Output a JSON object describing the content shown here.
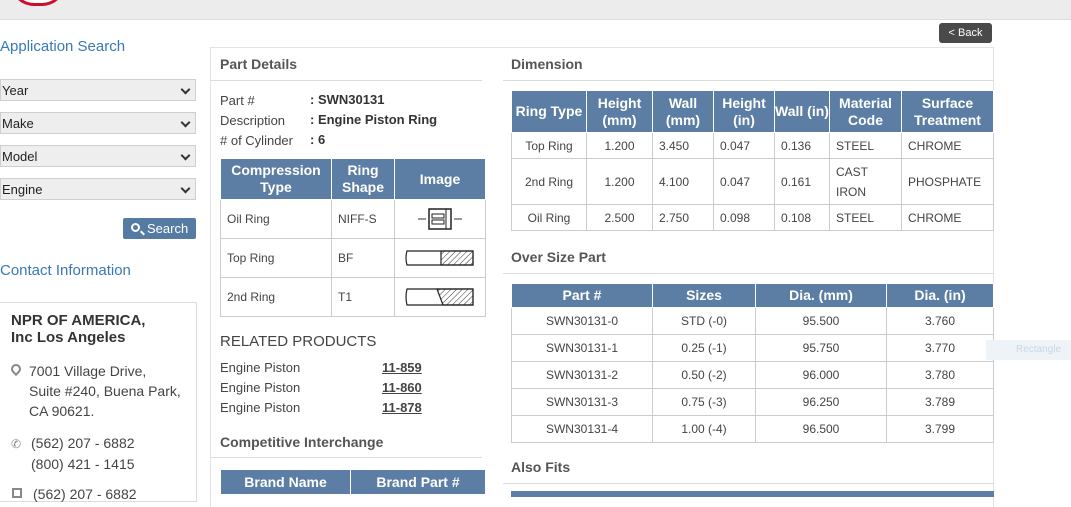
{
  "sidebar": {
    "app_search_title": "Application Search",
    "selects": [
      "Year",
      "Make",
      "Model",
      "Engine"
    ],
    "search_label": "Search",
    "contact_title": "Contact Information",
    "company_line1": "NPR OF AMERICA,",
    "company_line2": "Inc Los Angeles",
    "address_lines": [
      "7001 Village Drive,",
      "Suite #240, Buena Park,",
      "CA 90621."
    ],
    "phones": [
      "(562) 207 - 6882",
      "(800) 421 - 1415"
    ],
    "fax": "(562) 207 - 6882"
  },
  "back_label": "< Back",
  "part_details": {
    "title": "Part Details",
    "part_label": "Part #",
    "part_value": ": SWN30131",
    "desc_label": "Description",
    "desc_value": ": Engine Piston Ring",
    "cyl_label": "# of Cylinder",
    "cyl_value": ": 6",
    "ring_table": {
      "headers": [
        "Compression Type",
        "Ring Shape",
        "Image"
      ],
      "rows": [
        {
          "type": "Oil Ring",
          "shape": "NIFF-S",
          "image_icon": "oil-ring-profile-icon"
        },
        {
          "type": "Top Ring",
          "shape": "BF",
          "image_icon": "top-ring-profile-icon"
        },
        {
          "type": "2nd Ring",
          "shape": "T1",
          "image_icon": "second-ring-profile-icon"
        }
      ]
    }
  },
  "related": {
    "title": "RELATED PRODUCTS",
    "items": [
      {
        "name": "Engine Piston",
        "part": "11-859"
      },
      {
        "name": "Engine Piston",
        "part": "11-860"
      },
      {
        "name": "Engine Piston",
        "part": "11-878"
      }
    ]
  },
  "interchange": {
    "title": "Competitive Interchange",
    "headers": [
      "Brand Name",
      "Brand Part #"
    ]
  },
  "dimension": {
    "title": "Dimension",
    "headers": [
      "Ring Type",
      "Height (mm)",
      "Wall (mm)",
      "Height (in)",
      "Wall (in)",
      "Material Code",
      "Surface Treatment"
    ],
    "rows": [
      [
        "Top Ring",
        "1.200",
        "3.450",
        "0.047",
        "0.136",
        "STEEL",
        "CHROME"
      ],
      [
        "2nd Ring",
        "1.200",
        "4.100",
        "0.047",
        "0.161",
        "CAST IRON",
        "PHOSPHATE"
      ],
      [
        "Oil Ring",
        "2.500",
        "2.750",
        "0.098",
        "0.108",
        "STEEL",
        "CHROME"
      ]
    ]
  },
  "oversize": {
    "title": "Over Size Part",
    "headers": [
      "Part #",
      "Sizes",
      "Dia. (mm)",
      "Dia. (in)"
    ],
    "rows": [
      [
        "SWN30131-0",
        "STD (-0)",
        "95.500",
        "3.760"
      ],
      [
        "SWN30131-1",
        "0.25 (-1)",
        "95.750",
        "3.770"
      ],
      [
        "SWN30131-2",
        "0.50 (-2)",
        "96.000",
        "3.780"
      ],
      [
        "SWN30131-3",
        "0.75 (-3)",
        "96.250",
        "3.789"
      ],
      [
        "SWN30131-4",
        "1.00 (-4)",
        "96.500",
        "3.799"
      ]
    ]
  },
  "also_fits": {
    "title": "Also Fits"
  },
  "ghost_label": "Rectangle",
  "colors": {
    "header_blue": "#5d7ea4",
    "link_blue": "#3a78b8",
    "logo_red": "#c8102e"
  }
}
